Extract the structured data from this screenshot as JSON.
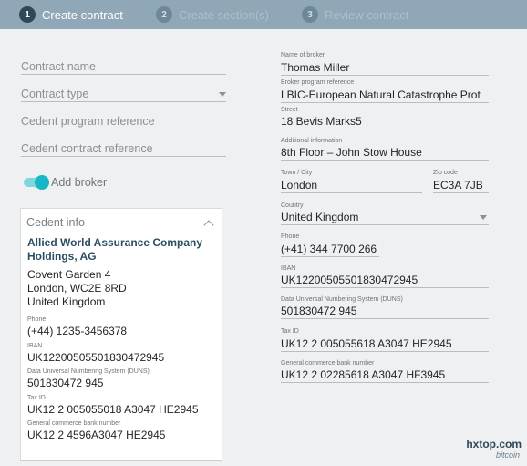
{
  "stepper": {
    "steps": [
      {
        "number": "1",
        "label": "Create contract"
      },
      {
        "number": "2",
        "label": "Create section(s)"
      },
      {
        "number": "3",
        "label": "Review contract"
      }
    ]
  },
  "contract_form": {
    "contract_name": {
      "placeholder": "Contract name"
    },
    "contract_type": {
      "placeholder": "Contract type"
    },
    "cedent_program_reference": {
      "placeholder": "Cedent program reference"
    },
    "cedent_contract_reference": {
      "placeholder": "Cedent contract reference"
    },
    "add_broker": {
      "label": "Add broker",
      "enabled": true
    }
  },
  "cedent_info": {
    "title": "Cedent info",
    "company": "Allied World Assurance Company Holdings, AG",
    "address_line1": "Covent Garden 4",
    "address_line2": "London, WC2E 8RD",
    "address_line3": "United Kingdom",
    "phone_label": "Phone",
    "phone": "(+44) 1235-3456378",
    "iban_label": "IBAN",
    "iban": "UK12200505501830472945",
    "duns_label": "Data Universal Numbering System (DUNS)",
    "duns": "501830472 945",
    "tax_label": "Tax ID",
    "tax_id": "UK12 2 005055018 A3047 HE2945",
    "bank_label": "General commerce bank number",
    "bank_number": "UK12 2 4596A3047 HE2945"
  },
  "broker": {
    "name_label": "Name of broker",
    "name": "Thomas Miller",
    "program_label": "Broker program reference",
    "program": "LBIC-European Natural Catastrophe Prot",
    "street_label": "Street",
    "street": "18 Bevis Marks5",
    "additional_label": "Additional information",
    "additional": "8th Floor – John Stow House",
    "city_label": "Town / City",
    "city": "London",
    "zip_label": "Zip code",
    "zip": "EC3A 7JB",
    "country_label": "Country",
    "country": "United Kingdom",
    "phone_label": "Phone",
    "phone": "(+41) 344 7700 266",
    "iban_label": "IBAN",
    "iban": "UK12200505501830472945",
    "duns_label": "Data Universal Numbering System (DUNS)",
    "duns": "501830472 945",
    "tax_label": "Tax ID",
    "tax_id": "UK12 2 005055618 A3047 HE2945",
    "bank_label": "General commerce bank number",
    "bank_number": "UK12 2 02285618 A3047 HF3945"
  },
  "watermark": {
    "site": "hxtop.com",
    "sub": "bitcoin"
  },
  "colors": {
    "header": "#8fa7b6",
    "accent": "#19b6c7",
    "company_text": "#2b4e63"
  }
}
